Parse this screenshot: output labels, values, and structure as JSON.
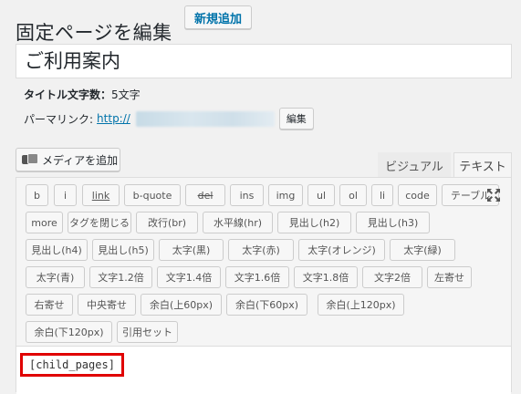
{
  "header": {
    "title": "固定ページを編集",
    "add_new_label": "新規追加"
  },
  "post_title": {
    "value": "ご利用案内"
  },
  "title_count": {
    "label": "タイトル文字数：",
    "value": "5文字"
  },
  "permalink": {
    "label": "パーマリンク:",
    "url_prefix": "http://",
    "edit_label": "編集"
  },
  "media": {
    "add_media_label": "メディアを追加",
    "icon": "media-icon"
  },
  "tabs": {
    "visual": "ビジュアル",
    "text": "テキスト",
    "active": "text"
  },
  "quicktags": [
    "b",
    "i",
    "link",
    "b-quote",
    "del",
    "ins",
    "img",
    "ul",
    "ol",
    "li",
    "code",
    "テーブル",
    "more",
    "タグを閉じる",
    "改行(br)",
    "水平線(hr)",
    "見出し(h2)",
    "見出し(h3)",
    "見出し(h4)",
    "見出し(h5)",
    "太字(黒)",
    "太字(赤)",
    "太字(オレンジ)",
    "太字(緑)",
    "太字(青)",
    "文字1.2倍",
    "文字1.4倍",
    "文字1.6倍",
    "文字1.8倍",
    "文字2倍",
    "左寄せ",
    "右寄せ",
    "中央寄せ",
    "余白(上60px)",
    "余白(下60px)",
    "余白(上120px)",
    "余白(下120px)",
    "引用セット"
  ],
  "editor": {
    "content": "[child_pages]",
    "fullscreen_icon": "fullscreen-icon",
    "highlight_color": "#e00000"
  }
}
